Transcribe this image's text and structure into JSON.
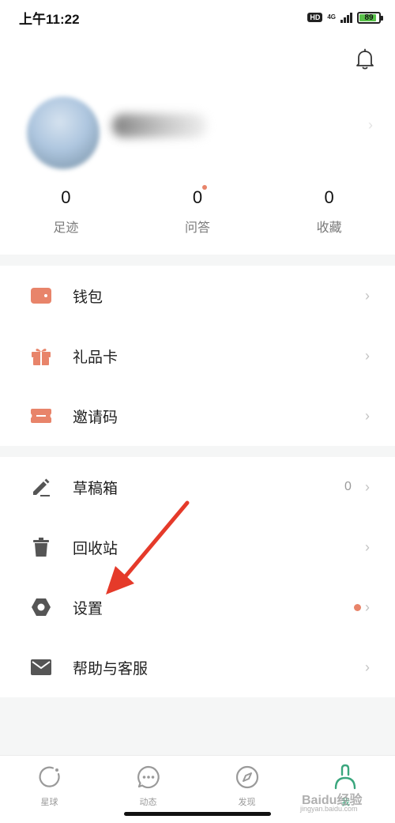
{
  "status_bar": {
    "time": "上午11:22",
    "hd": "HD",
    "network": "4G",
    "battery": "89",
    "battery_level": 0.89
  },
  "profile": {
    "stats": [
      {
        "value": "0",
        "label": "足迹",
        "has_dot": false
      },
      {
        "value": "0",
        "label": "问答",
        "has_dot": true
      },
      {
        "value": "0",
        "label": "收藏",
        "has_dot": false
      }
    ]
  },
  "menu_group_1": [
    {
      "label": "钱包",
      "icon": "wallet-icon"
    },
    {
      "label": "礼品卡",
      "icon": "gift-icon"
    },
    {
      "label": "邀请码",
      "icon": "ticket-icon"
    }
  ],
  "menu_group_2": [
    {
      "label": "草稿箱",
      "icon": "pencil-icon",
      "count": "0"
    },
    {
      "label": "回收站",
      "icon": "trash-icon"
    },
    {
      "label": "设置",
      "icon": "settings-icon",
      "has_dot": true
    },
    {
      "label": "帮助与客服",
      "icon": "mail-icon"
    }
  ],
  "tabbar": {
    "tabs": [
      {
        "label": "星球",
        "icon": "planet-icon"
      },
      {
        "label": "动态",
        "icon": "chat-bubble-icon"
      },
      {
        "label": "发现",
        "icon": "compass-icon"
      },
      {
        "label": "我",
        "icon": "profile-icon"
      }
    ]
  },
  "watermark": {
    "text": "Baidu经验",
    "sub": "jingyan.baidu.com"
  },
  "colors": {
    "accent_orange": "#e8846a",
    "icon_gray": "#555555",
    "active_green": "#3aa67d",
    "battery_green": "#59c24a"
  }
}
